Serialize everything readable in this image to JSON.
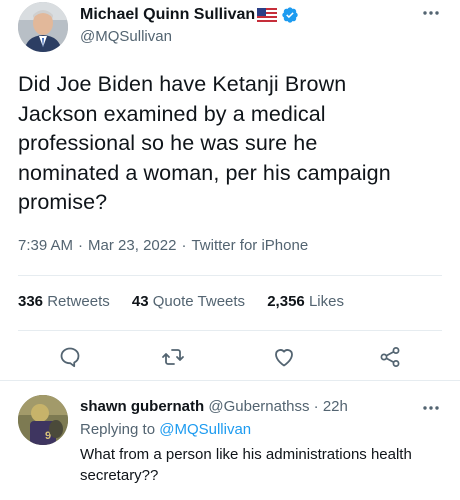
{
  "author": {
    "name": "Michael Quinn Sullivan",
    "handle": "@MQSullivan"
  },
  "tweet": {
    "text": "Did Joe Biden have Ketanji Brown\nJackson examined by a medical\nprofessional so he was sure he\nnominated a woman, per his campaign\npromise?",
    "time": "7:39 AM",
    "date": "Mar 23, 2022",
    "separator": "·",
    "source": "Twitter for iPhone"
  },
  "stats": {
    "retweets_count": "336",
    "retweets_label": "Retweets",
    "quotes_count": "43",
    "quotes_label": "Quote Tweets",
    "likes_count": "2,356",
    "likes_label": "Likes"
  },
  "reply": {
    "name": "shawn gubernath",
    "handle": "@Gubernathss",
    "separator": "·",
    "age": "22h",
    "replying_prefix": "Replying to",
    "replying_to": "@MQSullivan",
    "text": "What from a person like his administrations health secretary??"
  },
  "icons": {
    "verified": "verified-badge-icon",
    "flag": "us-flag-icon",
    "more": "more-options-icon",
    "reply": "reply-icon",
    "retweet": "retweet-icon",
    "like": "heart-icon",
    "share": "share-icon"
  },
  "colors": {
    "text_primary": "#0f1419",
    "text_secondary": "#536471",
    "accent": "#1d9bf0",
    "divider": "#e6ecf0"
  }
}
